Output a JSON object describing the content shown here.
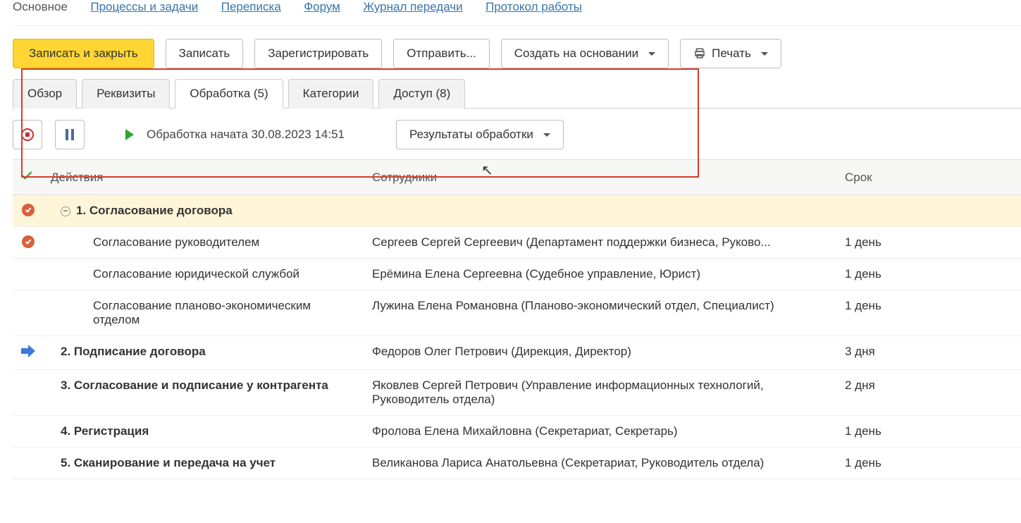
{
  "nav": {
    "main": "Основное",
    "processes": "Процессы и задачи",
    "correspondence": "Переписка",
    "forum": "Форум",
    "transfer_log": "Журнал передачи",
    "work_protocol": "Протокол работы"
  },
  "toolbar": {
    "save_close": "Записать и закрыть",
    "save": "Записать",
    "register": "Зарегистрировать",
    "send": "Отправить...",
    "create_based": "Создать на основании",
    "print": "Печать"
  },
  "tabs": {
    "overview": "Обзор",
    "requisites": "Реквизиты",
    "processing": "Обработка (5)",
    "categories": "Категории",
    "access": "Доступ (8)"
  },
  "processing": {
    "status": "Обработка начата 30.08.2023 14:51",
    "results_btn": "Результаты обработки"
  },
  "table": {
    "headers": {
      "actions": "Действия",
      "employees": "Сотрудники",
      "term": "Срок"
    },
    "rows": [
      {
        "mark": "circle",
        "expand": true,
        "bold": true,
        "indent": 1,
        "action": "1. Согласование договора",
        "emp": "",
        "term": "",
        "head": true
      },
      {
        "mark": "circle",
        "indent": 2,
        "action": "Согласование руководителем",
        "emp": "Сергеев Сергей Сергеевич (Департамент поддержки бизнеса, Руково...",
        "term": "1 день"
      },
      {
        "mark": "",
        "indent": 2,
        "action": "Согласование юридической службой",
        "emp": "Ерёмина Елена Сергеевна (Судебное управление, Юрист)",
        "term": "1 день"
      },
      {
        "mark": "",
        "indent": 2,
        "action": "Согласование планово-экономическим отделом",
        "emp": "Лужина Елена Романовна (Планово-экономический отдел, Специалист)",
        "term": "1 день"
      },
      {
        "mark": "arrow",
        "bold": true,
        "indent": 1,
        "action": "2. Подписание договора",
        "emp": "Федоров Олег Петрович (Дирекция, Директор)",
        "term": "3 дня"
      },
      {
        "mark": "",
        "bold": true,
        "indent": 1,
        "action": "3. Согласование и подписание у контрагента",
        "emp": "Яковлев Сергей Петрович (Управление информационных технологий, Руководитель отдела)",
        "term": "2 дня"
      },
      {
        "mark": "",
        "bold": true,
        "indent": 1,
        "action": "4. Регистрация",
        "emp": "Фролова Елена Михайловна (Секретариат, Секретарь)",
        "term": "1 день"
      },
      {
        "mark": "",
        "bold": true,
        "indent": 1,
        "action": "5. Сканирование и передача на учет",
        "emp": "Великанова Лариса Анатольевна (Секретариат, Руководитель отдела)",
        "term": "1 день"
      }
    ]
  }
}
